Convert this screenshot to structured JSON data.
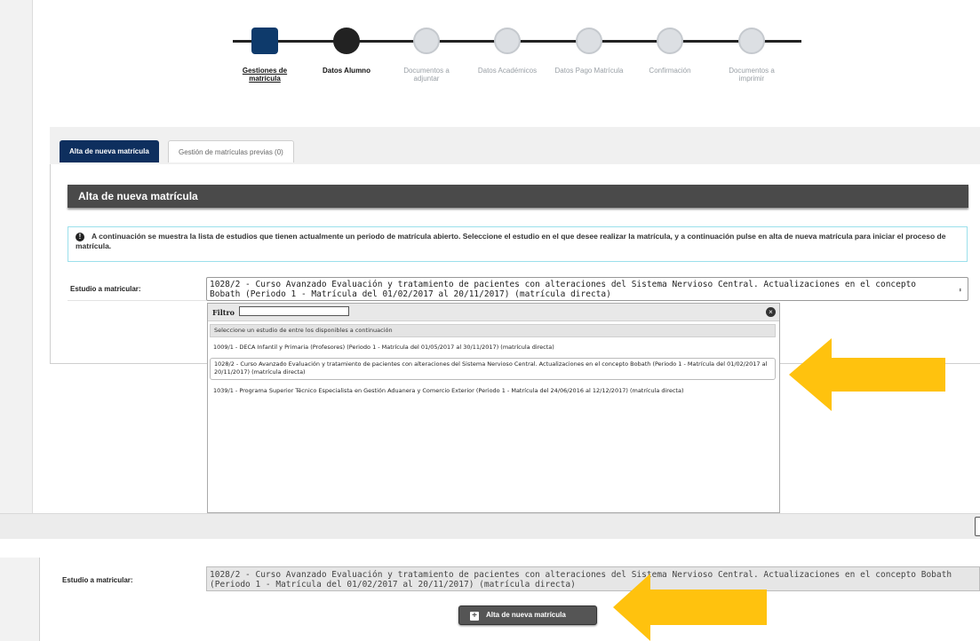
{
  "stepper": {
    "steps": [
      {
        "label": "Gestiones de matrícula",
        "state": "done"
      },
      {
        "label": "Datos Alumno",
        "state": "current"
      },
      {
        "label": "Documentos a adjuntar",
        "state": "pending"
      },
      {
        "label": "Datos Académicos",
        "state": "pending"
      },
      {
        "label": "Datos Pago Matrícula",
        "state": "pending"
      },
      {
        "label": "Confirmación",
        "state": "pending"
      },
      {
        "label": "Documentos a imprimir",
        "state": "pending"
      }
    ]
  },
  "tabs": [
    {
      "label": "Alta de nueva matrícula",
      "active": true
    },
    {
      "label": "Gestión de matrículas previas (0)",
      "active": false
    }
  ],
  "section": {
    "title": "Alta de nueva matrícula",
    "info_text": "A continuación se muestra la lista de estudios que tienen actualmente un periodo de matrícula abierto. Seleccione el estudio en el que desee realizar la matrícula, y a continuación pulse en alta de nueva matrícula para iniciar el proceso de matrícula."
  },
  "form": {
    "field_label": "Estudio a matricular:",
    "selected_value": "1028/2 - Curso Avanzado Evaluación y tratamiento de pacientes con alteraciones del Sistema Nervioso Central. Actualizaciones en el concepto Bobath (Periodo 1 - Matrícula del 01/02/2017 al 20/11/2017) (matrícula directa)"
  },
  "dropdown": {
    "filter_label": "Filtro",
    "filter_value": "",
    "header": "Seleccione un estudio de entre los disponibles a continuación",
    "options": [
      {
        "text": "1009/1 - DECA Infantil y Primaria (Profesores) (Periodo 1 - Matrícula del 01/05/2017 al 30/11/2017) (matrícula directa)",
        "selected": false
      },
      {
        "text": "1028/2 - Curso Avanzado Evaluación y tratamiento de pacientes con alteraciones del Sistema Nervioso Central. Actualizaciones en el concepto Bobath (Periodo 1 - Matrícula del 01/02/2017 al 20/11/2017) (matrícula directa)",
        "selected": true
      },
      {
        "text": "1039/1 - Programa Superior Técnico Especialista en Gestión Aduanera y Comercio Exterior (Periodo 1 - Matrícula del 24/06/2016 al 12/12/2017) (matrícula directa)",
        "selected": false
      }
    ]
  },
  "second_view": {
    "field_label": "Estudio a matricular:",
    "selected_value": "1028/2 - Curso Avanzado Evaluación y tratamiento de pacientes con alteraciones del Sistema Nervioso Central. Actualizaciones en el concepto Bobath (Periodo 1 - Matrícula del 01/02/2017 al 20/11/2017) (matrícula directa)",
    "button_label": "Alta de nueva matrícula"
  },
  "colors": {
    "accent_navy": "#0e2f5e",
    "arrow": "#ffc20e",
    "header_dark": "#4a4a4a",
    "info_border": "#9be0ec"
  }
}
